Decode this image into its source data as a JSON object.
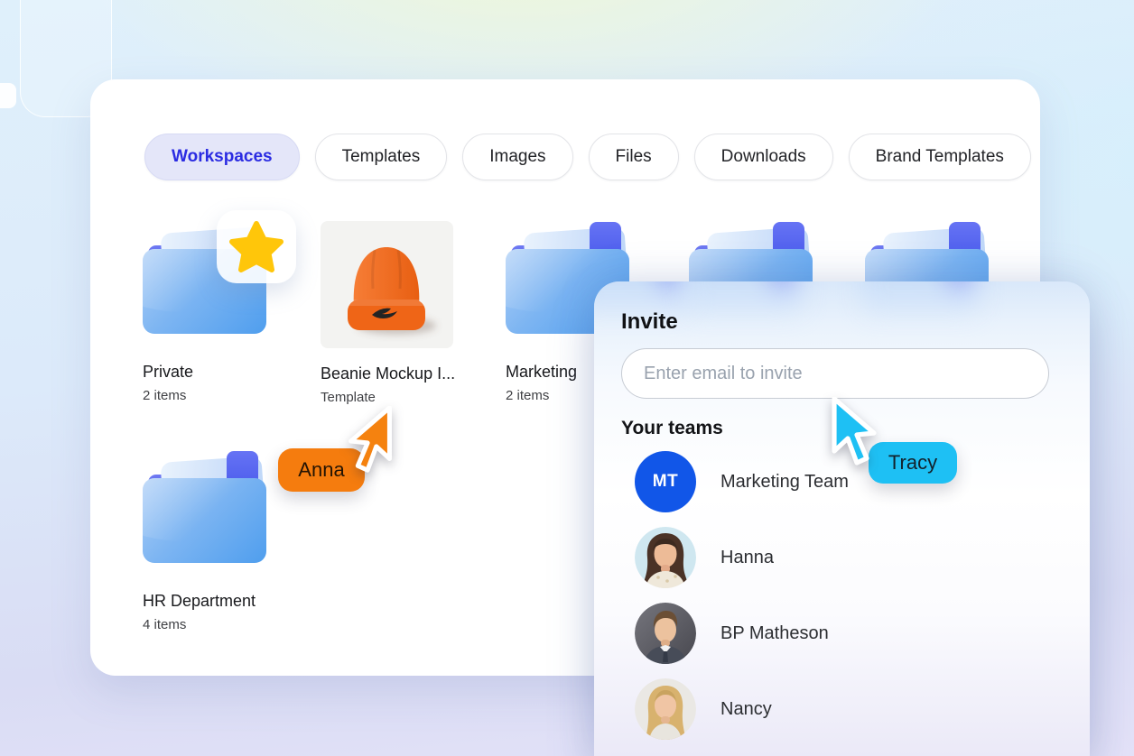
{
  "tabs": [
    {
      "label": "Workspaces",
      "selected": true
    },
    {
      "label": "Templates",
      "selected": false
    },
    {
      "label": "Images",
      "selected": false
    },
    {
      "label": "Files",
      "selected": false
    },
    {
      "label": "Downloads",
      "selected": false
    },
    {
      "label": "Brand Templates",
      "selected": false
    }
  ],
  "folders": [
    {
      "name": "Private",
      "meta": "2 items",
      "starred": true
    },
    {
      "name": "Beanie Mockup I...",
      "meta": "Template",
      "kind": "image"
    },
    {
      "name": "Marketing",
      "meta": "2 items",
      "bookmarked": true
    },
    {
      "bookmarked": true
    },
    {
      "bookmarked": true
    },
    {
      "name": "HR Department",
      "meta": "4 items",
      "bookmarked": true
    }
  ],
  "invite": {
    "title": "Invite",
    "input": {
      "value": "",
      "placeholder": "Enter email to invite"
    },
    "section_title": "Your teams",
    "team": {
      "initials": "MT",
      "name": "Marketing Team"
    },
    "members": [
      {
        "name": "Hanna"
      },
      {
        "name": "BP Matheson"
      },
      {
        "name": "Nancy"
      }
    ]
  },
  "cursors": [
    {
      "label": "Anna",
      "color": "#f57c0e"
    },
    {
      "label": "Tracy",
      "color": "#1ec0f4"
    }
  ],
  "colors": {
    "accent": "#2b2ce2",
    "tab_selected_bg": "#e4e6f9",
    "folder_blue": "#4f9eee",
    "bookmark_indigo": "#4050e8",
    "mt_avatar": "#1156e8",
    "star_gold": "#ffc60a"
  }
}
